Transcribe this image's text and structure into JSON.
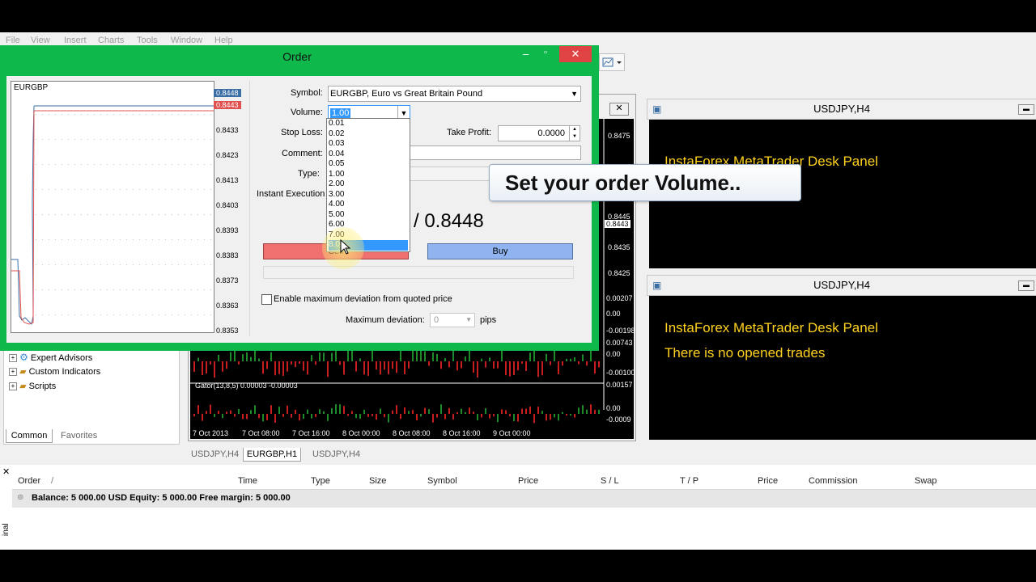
{
  "menu": [
    "File",
    "View",
    "Insert",
    "Charts",
    "Tools",
    "Window",
    "Help"
  ],
  "order_dialog": {
    "title": "Order",
    "mini_chart": {
      "symbol": "EURGBP",
      "price_labels": [
        "0.8448",
        "0.8443",
        "0.8433",
        "0.8423",
        "0.8413",
        "0.8403",
        "0.8393",
        "0.8383",
        "0.8373",
        "0.8363",
        "0.8353"
      ]
    },
    "symbol_label": "Symbol:",
    "symbol_value": "EURGBP, Euro vs Great Britain Pound",
    "volume_label": "Volume:",
    "volume_value": "1.00",
    "stop_loss_label": "Stop Loss:",
    "take_profit_label": "Take Profit:",
    "take_profit_value": "0.0000",
    "comment_label": "Comment:",
    "type_label": "Type:",
    "execution_label": "Instant Execution",
    "price_display": "/ 0.8448",
    "sell_label": "Sell",
    "buy_label": "Buy",
    "deviation_checkbox_label": "Enable maximum deviation from quoted price",
    "max_deviation_label": "Maximum deviation:",
    "max_deviation_value": "0",
    "pips_label": "pips",
    "volume_options": [
      "0.01",
      "0.02",
      "0.03",
      "0.04",
      "0.05",
      "1.00",
      "2.00",
      "3.00",
      "4.00",
      "5.00",
      "6.00",
      "7.00",
      "8.00"
    ],
    "volume_highlighted": "8.00"
  },
  "callout": {
    "text": "Set your order Volume.."
  },
  "center_chart": {
    "price_labels": [
      "0.8475",
      "0.8445",
      "0.8435",
      "0.8425"
    ],
    "current_price": "0.8443",
    "indicator_labels": [
      "0.00207",
      "0.00",
      "-0.00198",
      "0.00743",
      "0.00",
      "-0.00100",
      "0.00157",
      "0.00",
      "-0.0009"
    ],
    "gator_label": "Gator(13,8,5) 0.00003 -0.00003",
    "time_labels": [
      "7 Oct 2013",
      "7 Oct 08:00",
      "7 Oct 16:00",
      "8 Oct 00:00",
      "8 Oct 08:00",
      "8 Oct 16:00",
      "9 Oct 00:00"
    ]
  },
  "right_panels": [
    {
      "title": "USDJPY,H4",
      "line1": "InstaForex MetaTrader Desk Panel",
      "line2": "rades"
    },
    {
      "title": "USDJPY,H4",
      "line1": "InstaForex MetaTrader Desk Panel",
      "line2": "There is no opened trades"
    }
  ],
  "navigator": {
    "items": [
      "Expert Advisors",
      "Custom Indicators",
      "Scripts"
    ],
    "tabs": [
      "Common",
      "Favorites"
    ]
  },
  "chart_tabs": [
    "USDJPY,H4",
    "EURGBP,H1",
    "USDJPY,H4"
  ],
  "terminal": {
    "columns": [
      "Order",
      "/",
      "Time",
      "Type",
      "Size",
      "Symbol",
      "Price",
      "S / L",
      "T / P",
      "Price",
      "Commission",
      "Swap"
    ],
    "balance_row": "Balance: 5 000.00 USD  Equity: 5 000.00  Free margin: 5 000.00",
    "side_label": "inal"
  },
  "colors": {
    "dialog_frame": "#0fb84b",
    "sell": "#f07070",
    "buy": "#8fb4f0",
    "panel_text": "#ffd21f",
    "dropdown_highlight": "#3399ff"
  }
}
